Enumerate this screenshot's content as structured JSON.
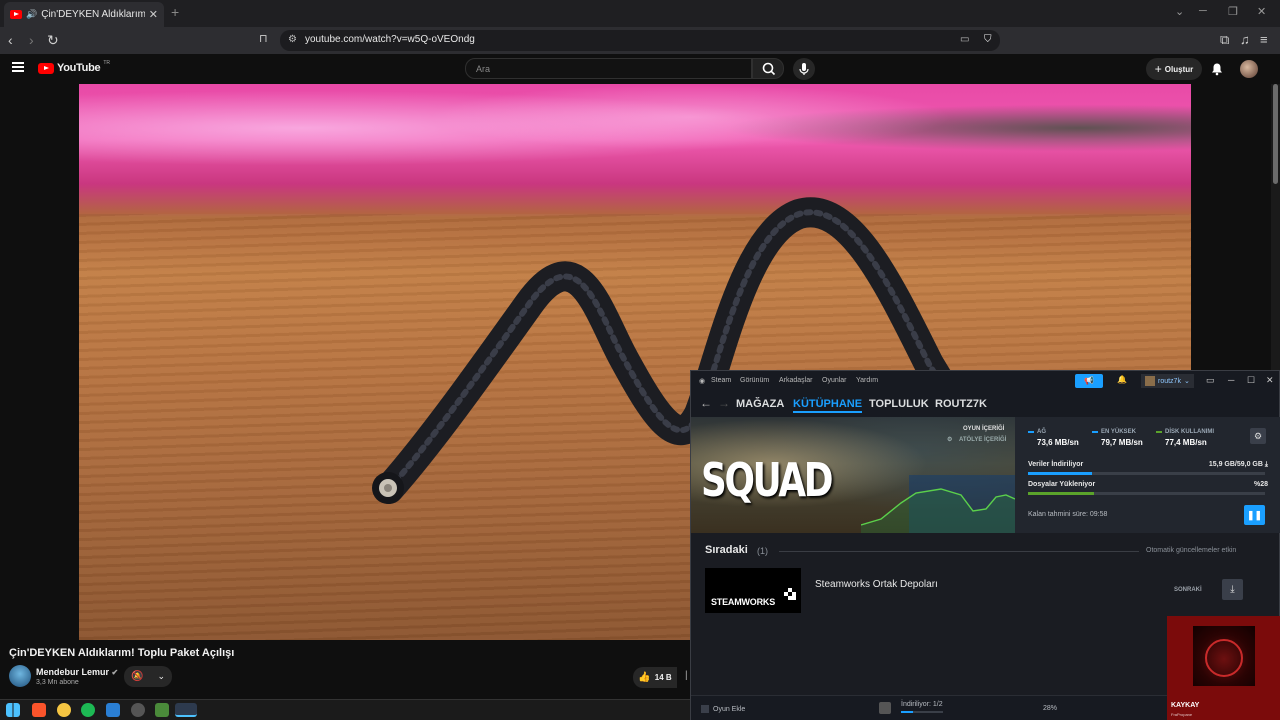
{
  "browser": {
    "tab_title": "Çin'DEYKEN Aldıklarım! Toplu",
    "url": "youtube.com/watch?v=w5Q-oVEOndg"
  },
  "youtube": {
    "logo_text": "YouTube",
    "logo_country": "TR",
    "search_placeholder": "Ara",
    "create_label": "Oluştur",
    "video_title": "Çin'DEYKEN Aldıklarım! Toplu Paket Açılışı",
    "channel_name": "Mendebur Lemur",
    "channel_subs": "3,3 Mn abone",
    "like_count": "14 B"
  },
  "steam": {
    "menu": [
      "Steam",
      "Görünüm",
      "Arkadaşlar",
      "Oyunlar",
      "Yardım"
    ],
    "username": "routz7k",
    "nav": [
      "MAĞAZA",
      "KÜTÜPHANE",
      "TOPLULUK",
      "ROUTZ7K"
    ],
    "active_nav": "KÜTÜPHANE",
    "hero_logo": "SQUAD",
    "hero_label_1": "OYUN İÇERİĞİ",
    "hero_label_2": "ATÖLYE İÇERİĞİ",
    "stats": [
      {
        "label": "AĞ",
        "value": "73,6 MB/sn",
        "color": "#1a9fff"
      },
      {
        "label": "EN YÜKSEK",
        "value": "79,7 MB/sn",
        "color": "#1a9fff"
      },
      {
        "label": "DİSK KULLANIMI",
        "value": "77,4 MB/sn",
        "color": "#5ba32b"
      }
    ],
    "downloading_label": "Veriler İndiriliyor",
    "downloading_value": "15,9 GB/59,0 GB",
    "downloading_fraction": 0.27,
    "installing_label": "Dosyalar Yükleniyor",
    "installing_value": "%28",
    "installing_fraction": 0.28,
    "eta": "Kalan tahmini süre: 09:58",
    "queue_title": "Sıradaki",
    "queue_count": "(1)",
    "auto_updates": "Otomatik güncellemeler etkin",
    "queue_item_logo": "STEAMWORKS",
    "queue_item_name": "Steamworks Ortak Depoları",
    "queue_next": "SONRAKİ",
    "add_game": "Oyun Ekle",
    "bottom_status": "İndiriliyor: 1/2",
    "bottom_pct": "28%"
  },
  "overlay": {
    "name": "KAYKAY",
    "sub": "FraPropane"
  }
}
